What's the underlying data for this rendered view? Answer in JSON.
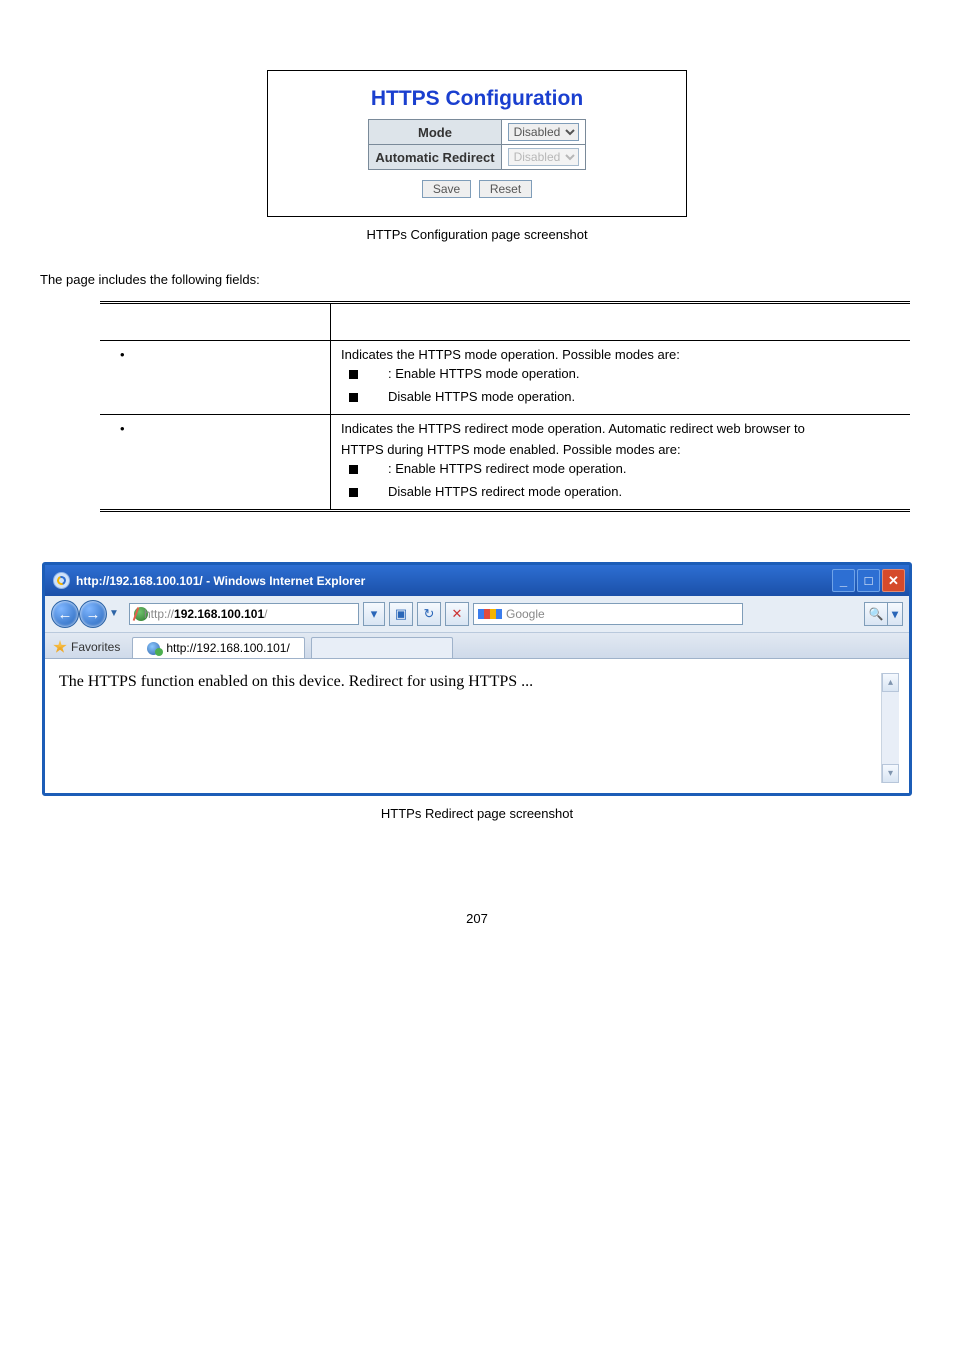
{
  "config_panel": {
    "title": "HTTPS Configuration",
    "rows": [
      {
        "label": "Mode",
        "value": "Disabled",
        "enabled": true
      },
      {
        "label": "Automatic Redirect",
        "value": "Disabled",
        "enabled": false
      }
    ],
    "save": "Save",
    "reset": "Reset"
  },
  "caption1": "HTTPs Configuration page screenshot",
  "intro": "The page includes the following fields:",
  "fields": [
    {
      "lead": "Indicates the HTTPS mode operation. Possible modes are:",
      "bullets": [
        ": Enable HTTPS mode operation.",
        "Disable HTTPS mode operation."
      ]
    },
    {
      "lead": "Indicates the HTTPS redirect mode operation. Automatic redirect web browser to",
      "lead2": "HTTPS during HTTPS mode enabled. Possible modes are:",
      "bullets": [
        ": Enable HTTPS redirect mode operation.",
        "Disable HTTPS redirect mode operation."
      ]
    }
  ],
  "ie": {
    "title": "http://192.168.100.101/ - Windows Internet Explorer",
    "address_prefix": "http://",
    "address_bold": "192.168.100.101",
    "address_suffix": "/",
    "search_placeholder": "Google",
    "favorites": "Favorites",
    "tab_label": "http://192.168.100.101/",
    "content": "The HTTPS function enabled on this device. Redirect for using HTTPS ..."
  },
  "caption2": "HTTPs Redirect page screenshot",
  "page_number": "207"
}
